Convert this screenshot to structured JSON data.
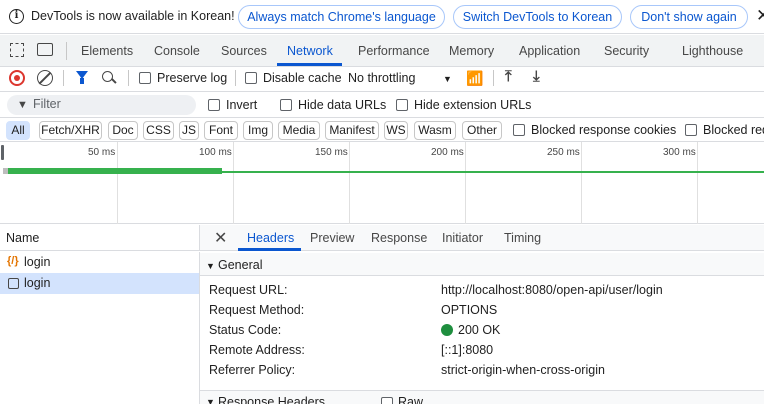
{
  "infobar": {
    "message": "DevTools is now available in Korean!",
    "btn_match": "Always match Chrome's language",
    "btn_switch": "Switch DevTools to Korean",
    "btn_dismiss": "Don't show again"
  },
  "main_tabs": {
    "elements": "Elements",
    "console": "Console",
    "sources": "Sources",
    "network": "Network",
    "performance": "Performance",
    "memory": "Memory",
    "application": "Application",
    "security": "Security",
    "lighthouse": "Lighthouse",
    "active": "Network"
  },
  "toolbar": {
    "preserve_log": "Preserve log",
    "disable_cache": "Disable cache",
    "throttling": "No throttling"
  },
  "filter": {
    "placeholder": "Filter",
    "invert": "Invert",
    "hide_data_urls": "Hide data URLs",
    "hide_extension_urls": "Hide extension URLs"
  },
  "type_chips": [
    "All",
    "Fetch/XHR",
    "Doc",
    "CSS",
    "JS",
    "Font",
    "Img",
    "Media",
    "Manifest",
    "WS",
    "Wasm",
    "Other"
  ],
  "chip_checks": {
    "blocked_cookies": "Blocked response cookies",
    "blocked_requests": "Blocked requests"
  },
  "timeline": {
    "ticks": [
      "50 ms",
      "100 ms",
      "150 ms",
      "200 ms",
      "250 ms",
      "300 ms"
    ]
  },
  "requests": {
    "column_name": "Name",
    "items": [
      {
        "name": "login",
        "icon": "json-icon",
        "selected": false
      },
      {
        "name": "login",
        "icon": "document-icon",
        "selected": true
      }
    ]
  },
  "details": {
    "tabs": {
      "headers": "Headers",
      "preview": "Preview",
      "response": "Response",
      "initiator": "Initiator",
      "timing": "Timing"
    },
    "general_title": "General",
    "general": [
      {
        "key": "Request URL:",
        "value": "http://localhost:8080/open-api/user/login"
      },
      {
        "key": "Request Method:",
        "value": "OPTIONS"
      },
      {
        "key": "Status Code:",
        "value": "200 OK"
      },
      {
        "key": "Remote Address:",
        "value": "[::1]:8080"
      },
      {
        "key": "Referrer Policy:",
        "value": "strict-origin-when-cross-origin"
      }
    ],
    "response_headers_title": "Response Headers",
    "raw_label": "Raw"
  },
  "colors": {
    "accent": "#0b57d0",
    "record_red": "#dc362e",
    "status_green": "#1e8e3e",
    "timeline_green": "#36b14d"
  }
}
